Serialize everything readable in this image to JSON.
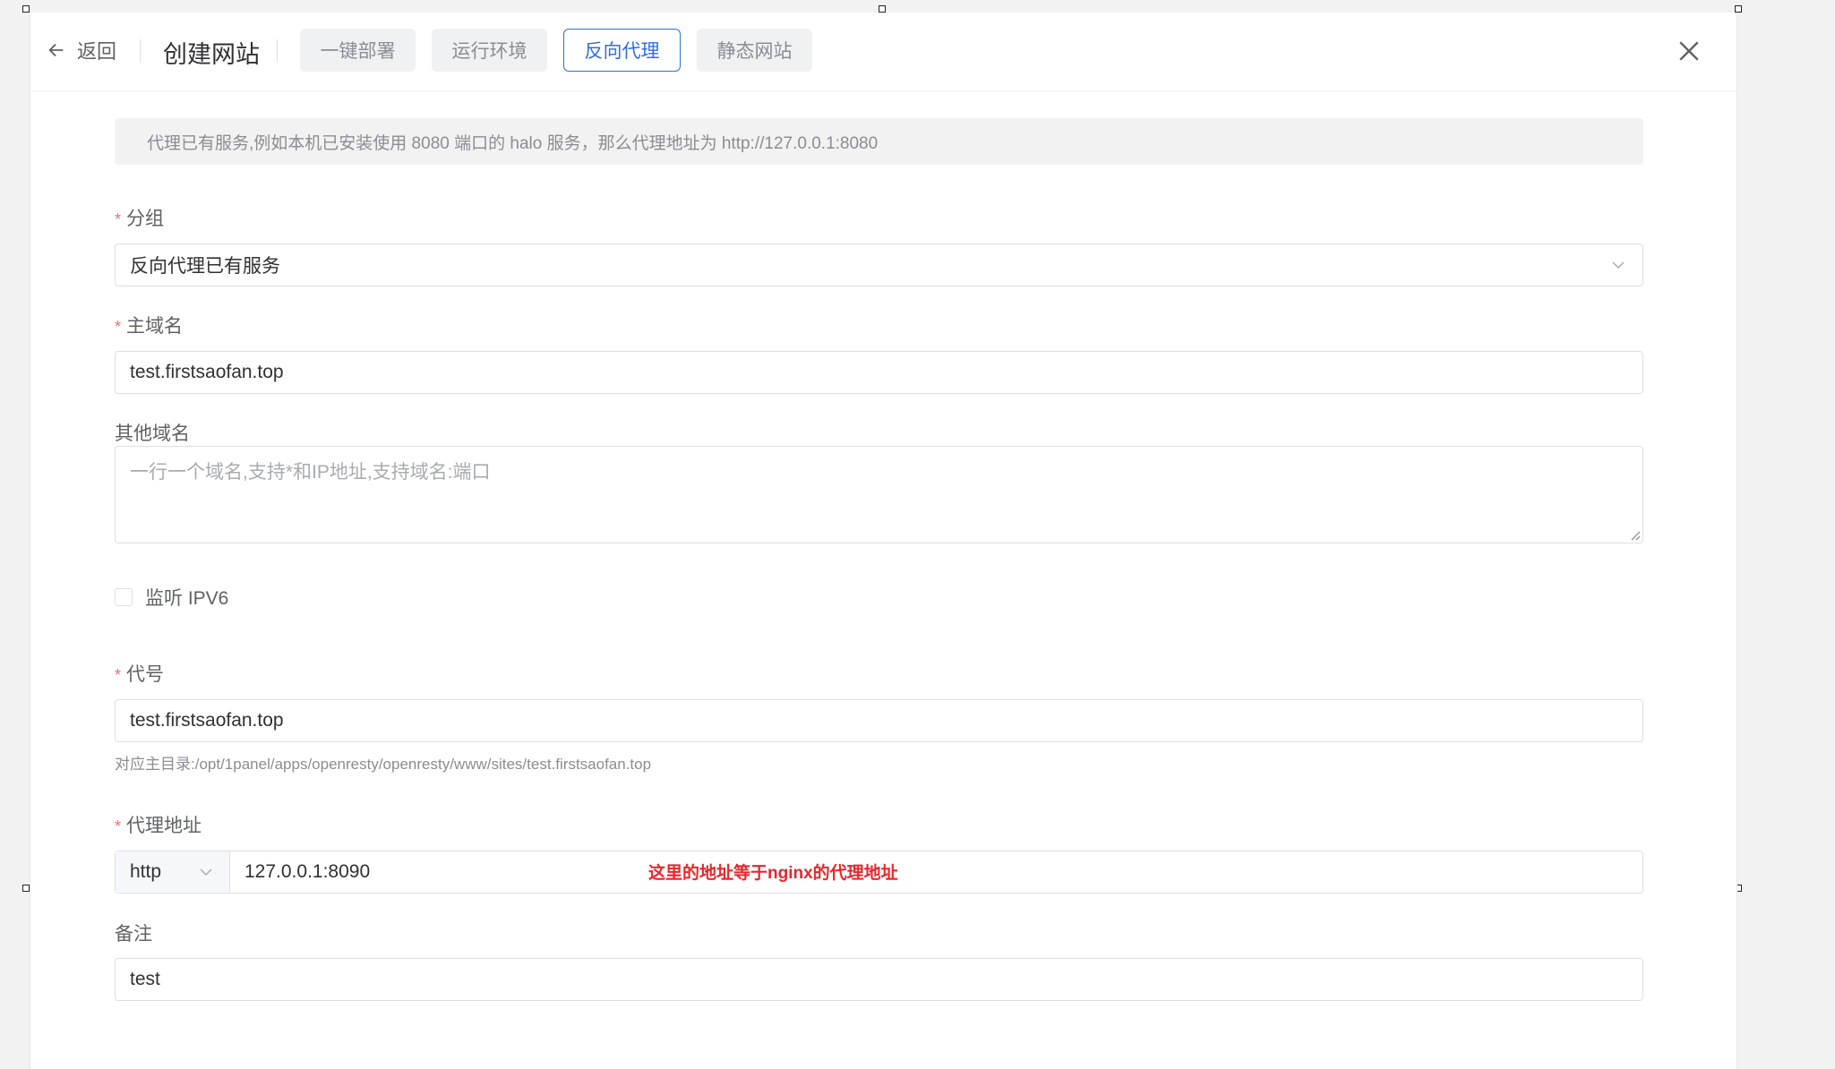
{
  "header": {
    "back_label": "返回",
    "title": "创建网站",
    "tabs": [
      {
        "label": "一键部署"
      },
      {
        "label": "运行环境"
      },
      {
        "label": "反向代理"
      },
      {
        "label": "静态网站"
      }
    ],
    "active_tab": "反向代理",
    "close_icon": "close-icon",
    "back_icon": "arrow-left-icon"
  },
  "form": {
    "alert": "代理已有服务,例如本机已安装使用 8080 端口的 halo 服务，那么代理地址为 http://127.0.0.1:8080",
    "required_mark": "*",
    "group": {
      "label": "分组",
      "value": "反向代理已有服务"
    },
    "primary_domain": {
      "label": "主域名",
      "value": "test.firstsaofan.top"
    },
    "other_domains": {
      "label": "其他域名",
      "placeholder": "一行一个域名,支持*和IP地址,支持域名:端口"
    },
    "ipv6": {
      "label": "监听 IPV6",
      "checked": false
    },
    "alias": {
      "label": "代号",
      "value": "test.firstsaofan.top",
      "hint": "对应主目录:/opt/1panel/apps/openresty/openresty/www/sites/test.firstsaofan.top"
    },
    "proxy": {
      "label": "代理地址",
      "protocol": "http",
      "value": "127.0.0.1:8090",
      "annotation": "这里的地址等于nginx的代理地址"
    },
    "remark": {
      "label": "备注",
      "value": "test"
    }
  },
  "colors": {
    "accent": "#2f6ee5",
    "required": "#f56c6c",
    "annotation": "#e8262a"
  }
}
